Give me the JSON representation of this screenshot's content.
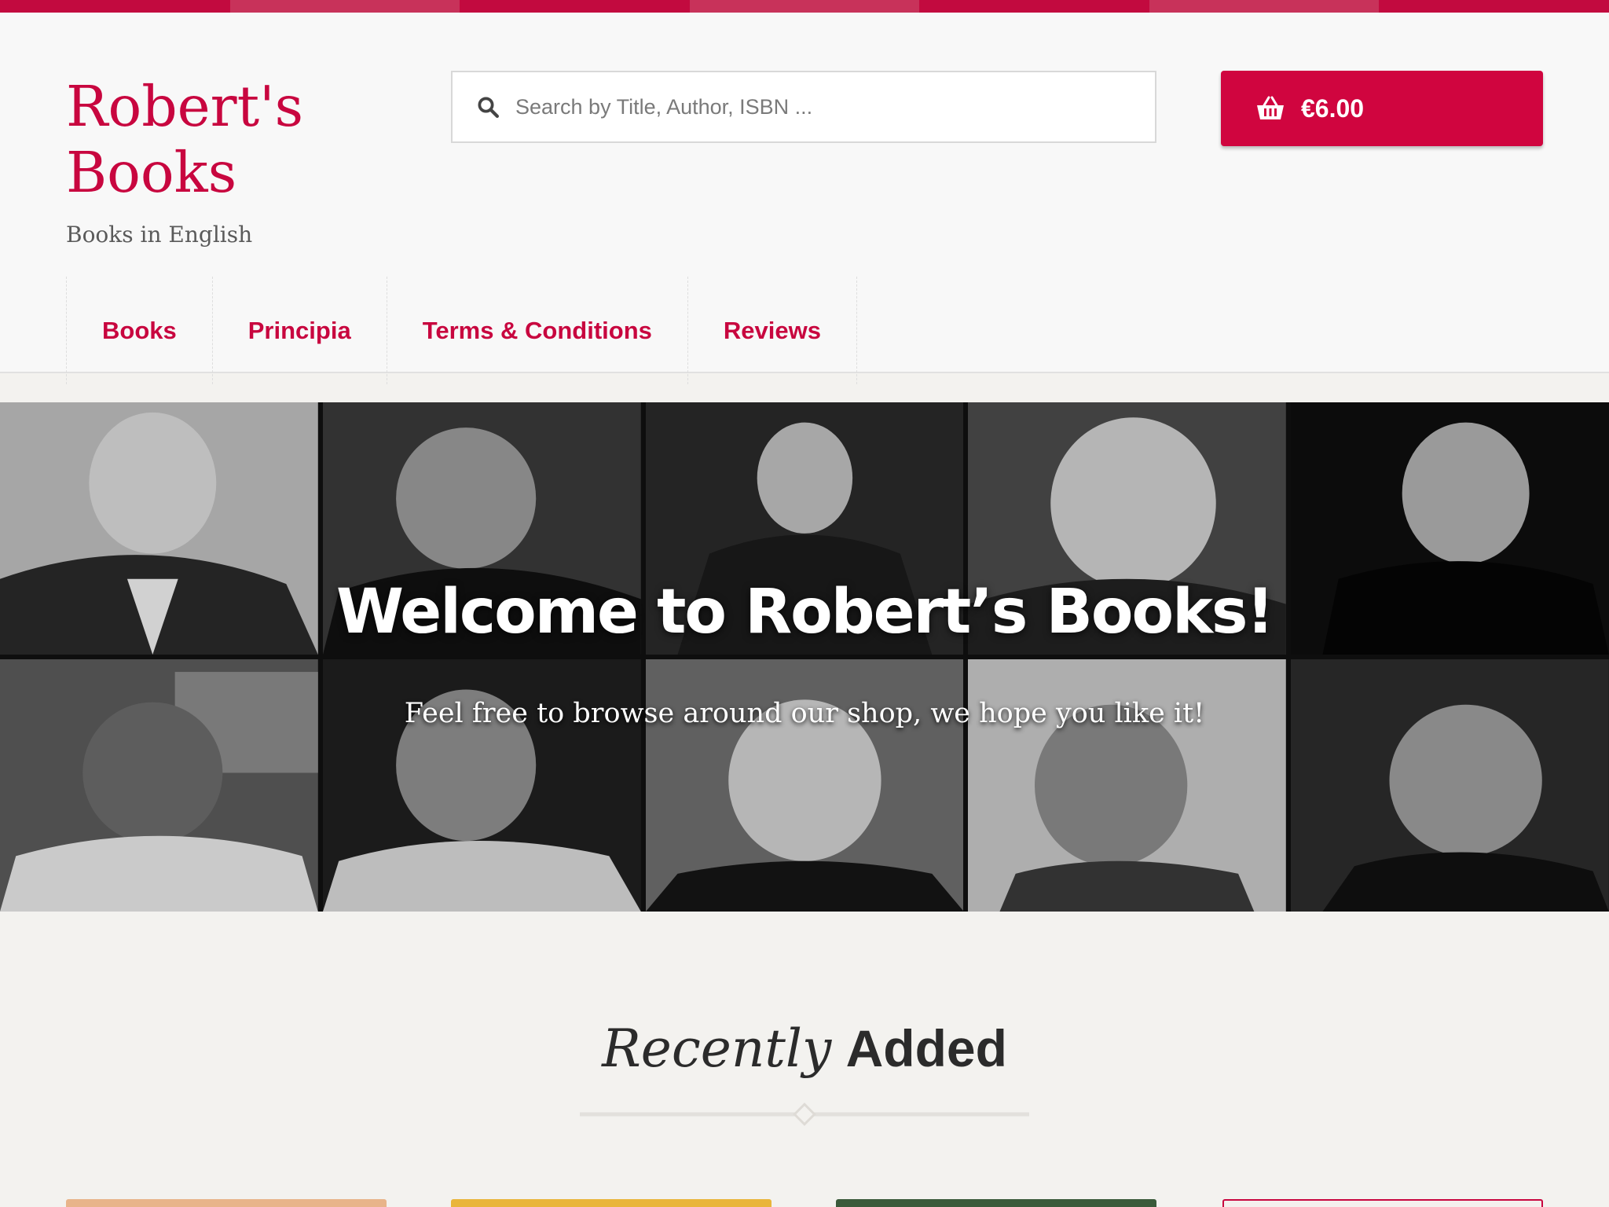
{
  "colors": {
    "brand": "#c8063f",
    "cart_bg": "#d0053f",
    "header_bg": "#f8f8f8",
    "page_bg": "#f3f2ef"
  },
  "site": {
    "title": "Robert's Books",
    "tagline": "Books in English"
  },
  "search": {
    "placeholder": "Search by Title, Author, ISBN ...",
    "icon": "search-icon"
  },
  "cart": {
    "total": "€6.00",
    "icon": "basket-icon"
  },
  "nav": {
    "items": [
      {
        "label": "Books"
      },
      {
        "label": "Principia"
      },
      {
        "label": "Terms & Conditions"
      },
      {
        "label": "Reviews"
      }
    ]
  },
  "hero": {
    "title": "Welcome to Robert’s Books!",
    "subtitle": "Feel free to browse around our shop, we hope you like it!",
    "portrait_count": 10
  },
  "section": {
    "title_em": "Recently",
    "title_strong": "Added"
  },
  "products": {
    "visible_count": 4,
    "cover_colors": [
      "#e8b48a",
      "#e9b53a",
      "#3a5a3a",
      "#f4f0ee"
    ]
  }
}
